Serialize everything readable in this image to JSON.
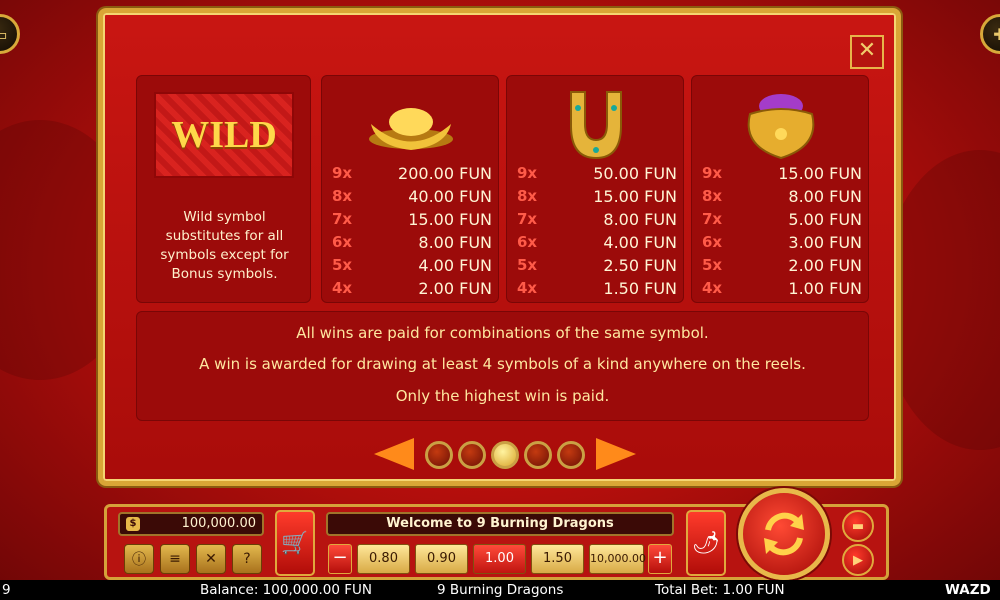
{
  "wild": {
    "logo": "WILD",
    "description": "Wild symbol substitutes for all symbols except for Bonus symbols."
  },
  "symbols": [
    {
      "icon": "gold-ingot-icon",
      "pays": [
        {
          "count": "9x",
          "value": "200.00 FUN"
        },
        {
          "count": "8x",
          "value": "40.00 FUN"
        },
        {
          "count": "7x",
          "value": "15.00 FUN"
        },
        {
          "count": "6x",
          "value": "8.00 FUN"
        },
        {
          "count": "5x",
          "value": "4.00 FUN"
        },
        {
          "count": "4x",
          "value": "2.00 FUN"
        }
      ]
    },
    {
      "icon": "horseshoe-icon",
      "pays": [
        {
          "count": "9x",
          "value": "50.00 FUN"
        },
        {
          "count": "8x",
          "value": "15.00 FUN"
        },
        {
          "count": "7x",
          "value": "8.00 FUN"
        },
        {
          "count": "6x",
          "value": "4.00 FUN"
        },
        {
          "count": "5x",
          "value": "2.50 FUN"
        },
        {
          "count": "4x",
          "value": "1.50 FUN"
        }
      ]
    },
    {
      "icon": "treasure-pot-icon",
      "pays": [
        {
          "count": "9x",
          "value": "15.00 FUN"
        },
        {
          "count": "8x",
          "value": "8.00 FUN"
        },
        {
          "count": "7x",
          "value": "5.00 FUN"
        },
        {
          "count": "6x",
          "value": "3.00 FUN"
        },
        {
          "count": "5x",
          "value": "2.00 FUN"
        },
        {
          "count": "4x",
          "value": "1.00 FUN"
        }
      ]
    }
  ],
  "info": [
    "All wins are paid for combinations of the same symbol.",
    "A win is awarded for drawing at least 4 symbols of a kind anywhere on the reels.",
    "Only the highest win is paid."
  ],
  "pagination": {
    "pages": 5,
    "active": 3
  },
  "controls": {
    "balance": "100,000.00",
    "welcome": "Welcome to 9 Burning Dragons",
    "bets": [
      "0.80",
      "0.90",
      "1.00",
      "1.50",
      "10,000.00"
    ],
    "selected_bet": "1.00",
    "minus": "−",
    "plus": "+"
  },
  "status": {
    "left_fragment": "9",
    "balance": "Balance: 100,000.00 FUN",
    "game": "9 Burning Dragons",
    "total_bet": "Total Bet: 1.00 FUN",
    "brand": "WAZD"
  },
  "colors": {
    "accent": "#d9a636",
    "panel": "#c91612",
    "pay_count": "#ff5b49"
  }
}
